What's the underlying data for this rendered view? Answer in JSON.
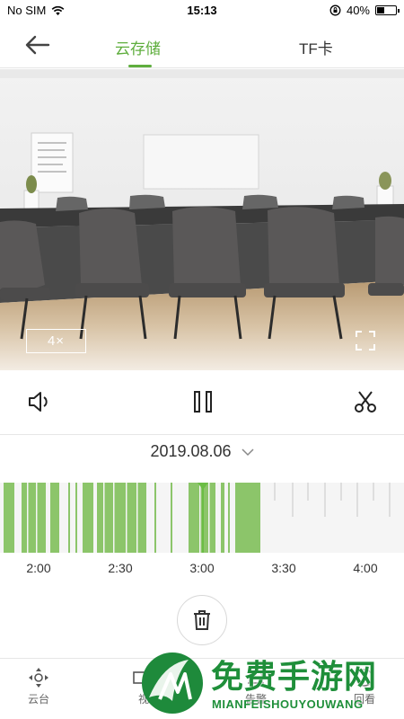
{
  "status_bar": {
    "carrier": "No SIM",
    "time": "15:13",
    "battery": "40%"
  },
  "nav": {
    "tab_cloud": "云存储",
    "tab_tf": "TF卡"
  },
  "player": {
    "zoom": "4×",
    "date": "2019.08.06"
  },
  "timeline": {
    "labels": [
      "2:00",
      "2:30",
      "3:00",
      "3:30",
      "4:00"
    ],
    "accent": "#8cc56a"
  },
  "bottom_nav": {
    "ptz": "云台",
    "video": "视",
    "alarm": "告警",
    "playback": "回看"
  },
  "watermark": {
    "title": "免费手游网",
    "subtitle": "MIANFEISHOUYOUWANG"
  },
  "colors": {
    "accent": "#5fae3e",
    "timeline_bar": "#8cc56a",
    "watermark": "#1f8f3a"
  }
}
